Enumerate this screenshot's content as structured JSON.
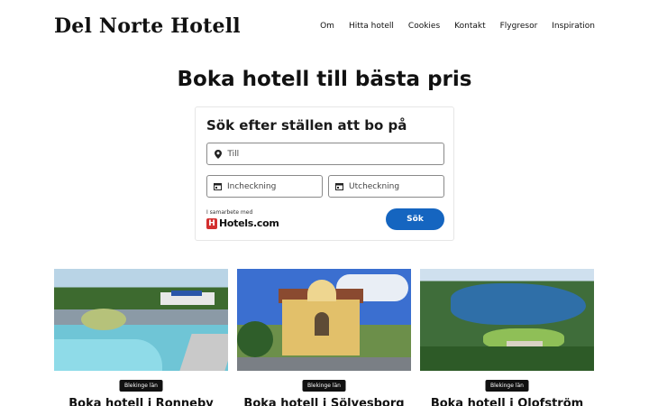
{
  "site": {
    "title": "Del Norte Hotell"
  },
  "nav": [
    "Om",
    "Hitta hotell",
    "Cookies",
    "Kontakt",
    "Flygresor",
    "Inspiration"
  ],
  "hero": {
    "title": "Boka hotell till bästa pris"
  },
  "search": {
    "heading": "Sök efter ställen att bo på",
    "destination_placeholder": "Till",
    "checkin_placeholder": "Incheckning",
    "checkout_placeholder": "Utcheckning",
    "partner_label": "I samarbete med",
    "partner_brand": "Hotels.com",
    "partner_badge": "H",
    "button_label": "Sök",
    "accent_color": "#1565c0"
  },
  "cards": [
    {
      "tag": "Blekinge län",
      "title": "Boka hotell i Ronneby"
    },
    {
      "tag": "Blekinge län",
      "title": "Boka hotell i Sölvesborg"
    },
    {
      "tag": "Blekinge län",
      "title": "Boka hotell i Olofström"
    }
  ],
  "icons": {
    "destination": "map-pin-icon",
    "checkin": "calendar-icon",
    "checkout": "calendar-icon"
  }
}
